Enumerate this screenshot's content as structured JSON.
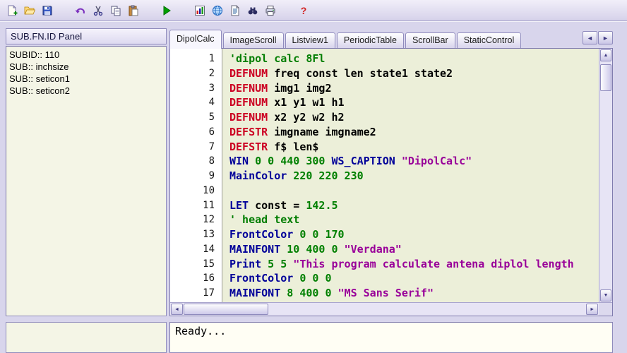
{
  "toolbar": {
    "groups": [
      [
        "new-file",
        "open-file",
        "save-file"
      ],
      [
        "undo",
        "cut",
        "copy",
        "paste"
      ],
      [
        "run"
      ],
      [
        "chart",
        "web",
        "document",
        "find",
        "print"
      ],
      [
        "help"
      ]
    ]
  },
  "left_panel": {
    "title": "SUB.FN.ID Panel",
    "items": [
      "SUBID:: 110",
      "SUB:: inchsize",
      "SUB:: seticon1",
      "SUB:: seticon2"
    ]
  },
  "tab_bar": {
    "tabs": [
      "DipolCalc",
      "ImageScroll",
      "Listview1",
      "PeriodicTable",
      "ScrollBar",
      "StaticControl"
    ],
    "active": "DipolCalc"
  },
  "icons": {
    "tab_prev": "◄",
    "tab_next": "►",
    "scroll_up": "▲",
    "scroll_down": "▼",
    "scroll_left": "◄",
    "scroll_right": "►"
  },
  "editor": {
    "lines": [
      {
        "n": "1",
        "s": [
          {
            "c": "comment",
            "t": "'dipol calc 8Fl"
          }
        ]
      },
      {
        "n": "2",
        "s": [
          {
            "c": "def",
            "t": "DEFNUM"
          },
          {
            "c": "plain",
            "t": " freq const len state1 state2"
          }
        ]
      },
      {
        "n": "3",
        "s": [
          {
            "c": "def",
            "t": "DEFNUM"
          },
          {
            "c": "plain",
            "t": " img1 img2"
          }
        ]
      },
      {
        "n": "4",
        "s": [
          {
            "c": "def",
            "t": "DEFNUM"
          },
          {
            "c": "plain",
            "t": " x1 y1 w1 h1"
          }
        ]
      },
      {
        "n": "5",
        "s": [
          {
            "c": "def",
            "t": "DEFNUM"
          },
          {
            "c": "plain",
            "t": " x2 y2 w2 h2"
          }
        ]
      },
      {
        "n": "6",
        "s": [
          {
            "c": "def",
            "t": "DEFSTR"
          },
          {
            "c": "plain",
            "t": " imgname imgname2"
          }
        ]
      },
      {
        "n": "7",
        "s": [
          {
            "c": "def",
            "t": "DEFSTR"
          },
          {
            "c": "plain",
            "t": " f$ len$"
          }
        ]
      },
      {
        "n": "8",
        "s": [
          {
            "c": "kw",
            "t": "WIN"
          },
          {
            "c": "num",
            "t": " 0 0 440 300"
          },
          {
            "c": "kw",
            "t": " WS_CAPTION"
          },
          {
            "c": "str",
            "t": " \"DipolCalc\""
          }
        ]
      },
      {
        "n": "9",
        "s": [
          {
            "c": "kw",
            "t": "MainColor"
          },
          {
            "c": "num",
            "t": " 220 220 230"
          }
        ]
      },
      {
        "n": "10",
        "s": []
      },
      {
        "n": "11",
        "s": [
          {
            "c": "kw",
            "t": "LET"
          },
          {
            "c": "plain",
            "t": " const = "
          },
          {
            "c": "num",
            "t": "142.5"
          }
        ]
      },
      {
        "n": "12",
        "s": [
          {
            "c": "comment",
            "t": "' head text"
          }
        ]
      },
      {
        "n": "13",
        "s": [
          {
            "c": "kw",
            "t": "FrontColor"
          },
          {
            "c": "num",
            "t": " 0 0 170"
          }
        ]
      },
      {
        "n": "14",
        "s": [
          {
            "c": "kw",
            "t": "MAINFONT"
          },
          {
            "c": "num",
            "t": " 10 400 0"
          },
          {
            "c": "str",
            "t": " \"Verdana\""
          }
        ]
      },
      {
        "n": "15",
        "s": [
          {
            "c": "kw",
            "t": "Print"
          },
          {
            "c": "num",
            "t": " 5 5"
          },
          {
            "c": "str",
            "t": " \"This program calculate antena diplol length"
          }
        ]
      },
      {
        "n": "16",
        "s": [
          {
            "c": "kw",
            "t": "FrontColor"
          },
          {
            "c": "num",
            "t": " 0 0 0"
          }
        ]
      },
      {
        "n": "17",
        "s": [
          {
            "c": "kw",
            "t": "MAINFONT"
          },
          {
            "c": "num",
            "t": " 8 400 0"
          },
          {
            "c": "str",
            "t": " \"MS Sans Serif\""
          }
        ]
      }
    ]
  },
  "status": {
    "text": "Ready..."
  },
  "colors": {
    "comment": "#007d00",
    "def_keyword": "#cc0022",
    "keyword": "#000099",
    "number": "#008000",
    "string": "#990099",
    "editor_bg": "#ecefd9",
    "window_bg": "#d8d5ec"
  }
}
